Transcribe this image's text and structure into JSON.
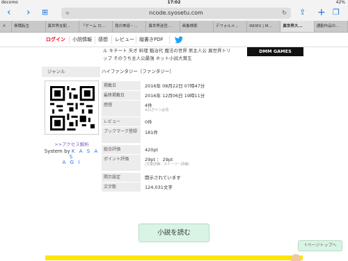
{
  "status": {
    "carrier": "docomo",
    "time": "17:02",
    "battery": "42%"
  },
  "browser": {
    "url": "ncode.syosetu.com",
    "tabs": [
      "メ",
      "無職転生",
      "異世界支配...",
      "「ゲーム ロ...",
      "我の美容・...",
      "異世界迷宮...",
      "画像検索",
      "デフォルメ...",
      "INDEX | M...",
      "異世界大...",
      "通勤作品の..."
    ]
  },
  "nav": {
    "login": "ログイン",
    "novel_info": "小説情報",
    "impressions": "感想",
    "review": "レビュー",
    "pdf": "縦書きPDF"
  },
  "keywords_text": "ル キチート 天才 料理 鍛冶代 魔法の世界 男主人公 異世界トリップ そのうち主人公最強 ネット小説大賞五",
  "ad": {
    "text": "DMM GAMES"
  },
  "genre": {
    "label": "ジャンル",
    "value": "ハイファンタジー〔ファンタジー〕"
  },
  "access": {
    "link": ">>アクセス解析",
    "system_prefix": "System by",
    "system_name_1": "K A S A S",
    "system_name_2": "A G I"
  },
  "info": [
    {
      "label": "掲載日",
      "value": "2016年 08月22日 07時47分",
      "sub": ""
    },
    {
      "label": "最終掲載日",
      "value": "2016年 12月06日 19時11分",
      "sub": ""
    },
    {
      "label": "感想",
      "value": "4件",
      "sub": "※ログイン必須"
    },
    {
      "label": "レビュー",
      "value": "0件",
      "sub": ""
    },
    {
      "label": "ブックマーク登録",
      "value": "181件",
      "sub": ""
    },
    {
      "label": "総合評価",
      "value": "420pt",
      "sub": ""
    },
    {
      "label": "ポイント評価",
      "value": "29pt ： 29pt",
      "sub": "(文章評価：ストーリー評価)"
    },
    {
      "label": "開示設定",
      "value": "開示されています",
      "sub": ""
    },
    {
      "label": "文字数",
      "value": "124,031文字",
      "sub": ""
    }
  ],
  "read_button": "小説を読む",
  "page_top": "↑ページトップへ",
  "colors": {
    "accent_green": "#d9f3e4",
    "login_red": "#e60012",
    "link_blue": "#1a73e8"
  }
}
